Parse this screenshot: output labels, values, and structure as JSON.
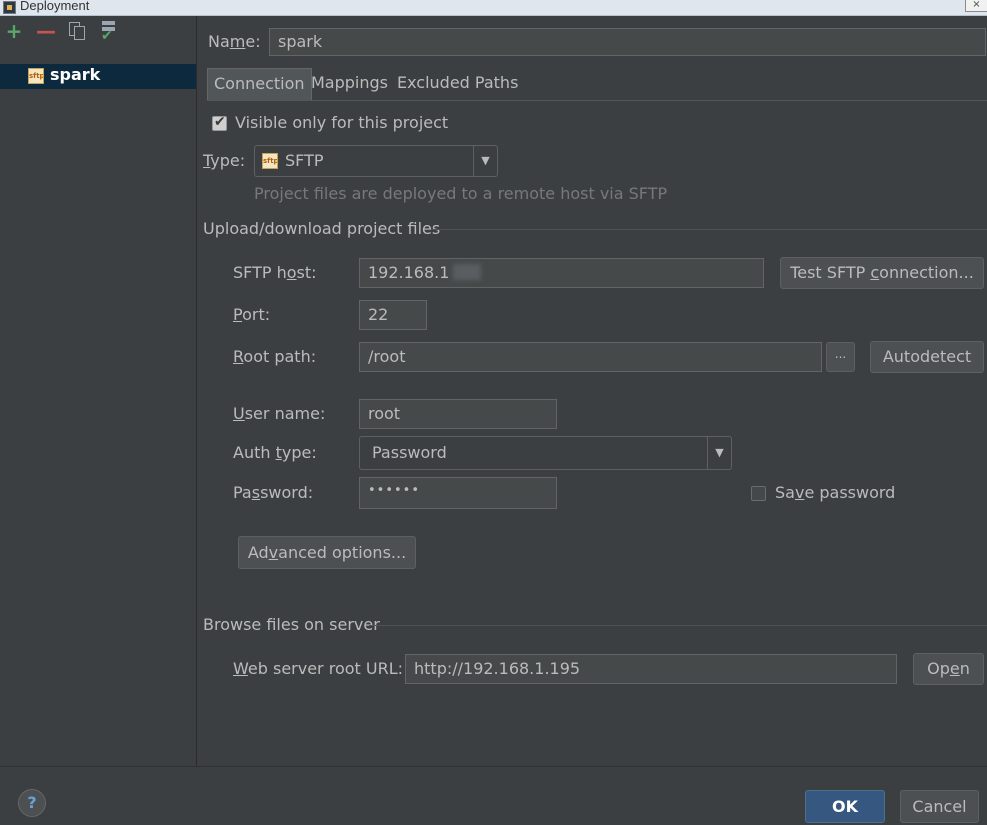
{
  "window": {
    "title": "Deployment",
    "close_glyph": "×"
  },
  "left": {
    "toolbar": {
      "add": "+",
      "remove": "—"
    },
    "servers": [
      {
        "name": "spark",
        "icon": "sftp-server-icon"
      }
    ]
  },
  "name_label": {
    "pre": "Na",
    "mnemonic": "m",
    "post": "e:"
  },
  "name_value": "spark",
  "tabs": [
    "Connection",
    "Mappings",
    "Excluded Paths"
  ],
  "visible_only_label": "Visible only for this project",
  "type": {
    "pre": "",
    "mnemonic": "T",
    "post": "ype:",
    "value": "SFTP",
    "icon_text": "sftp"
  },
  "type_hint": "Project files are deployed to a remote host via SFTP",
  "upload_section": "Upload/download project files",
  "sftp_host": {
    "pre": "SFTP h",
    "mnemonic": "o",
    "post": "st:",
    "value": "192.168.1"
  },
  "test_button": {
    "pre": "Test SFTP ",
    "mnemonic": "c",
    "post": "onnection..."
  },
  "port": {
    "pre": "",
    "mnemonic": "P",
    "post": "ort:",
    "value": "22"
  },
  "root_path": {
    "pre": "",
    "mnemonic": "R",
    "post": "oot path:",
    "value": "/root",
    "browse": "..."
  },
  "autodetect_button": "Autodetect",
  "user_name": {
    "pre": "",
    "mnemonic": "U",
    "post": "ser name:",
    "value": "root"
  },
  "auth_type": {
    "pre": "Auth ",
    "mnemonic": "t",
    "post": "ype:",
    "value": "Password"
  },
  "password": {
    "pre": "Pa",
    "mnemonic": "s",
    "post": "sword:",
    "value": "••••••"
  },
  "save_password": {
    "pre": "Sa",
    "mnemonic": "v",
    "post": "e password"
  },
  "advanced_button": {
    "pre": "Ad",
    "mnemonic": "v",
    "post": "anced options..."
  },
  "browse_section": "Browse files on server",
  "web_root": {
    "pre": "",
    "mnemonic": "W",
    "post": "eb server root URL:",
    "value": "http://192.168.1.195"
  },
  "open_button": {
    "pre": "Op",
    "mnemonic": "e",
    "post": "n"
  },
  "help": "?",
  "ok_button": "OK",
  "cancel_button": "Cancel",
  "colors": {
    "selection": "#0d293e",
    "ok_button": "#365880",
    "background": "#3c3f41"
  }
}
